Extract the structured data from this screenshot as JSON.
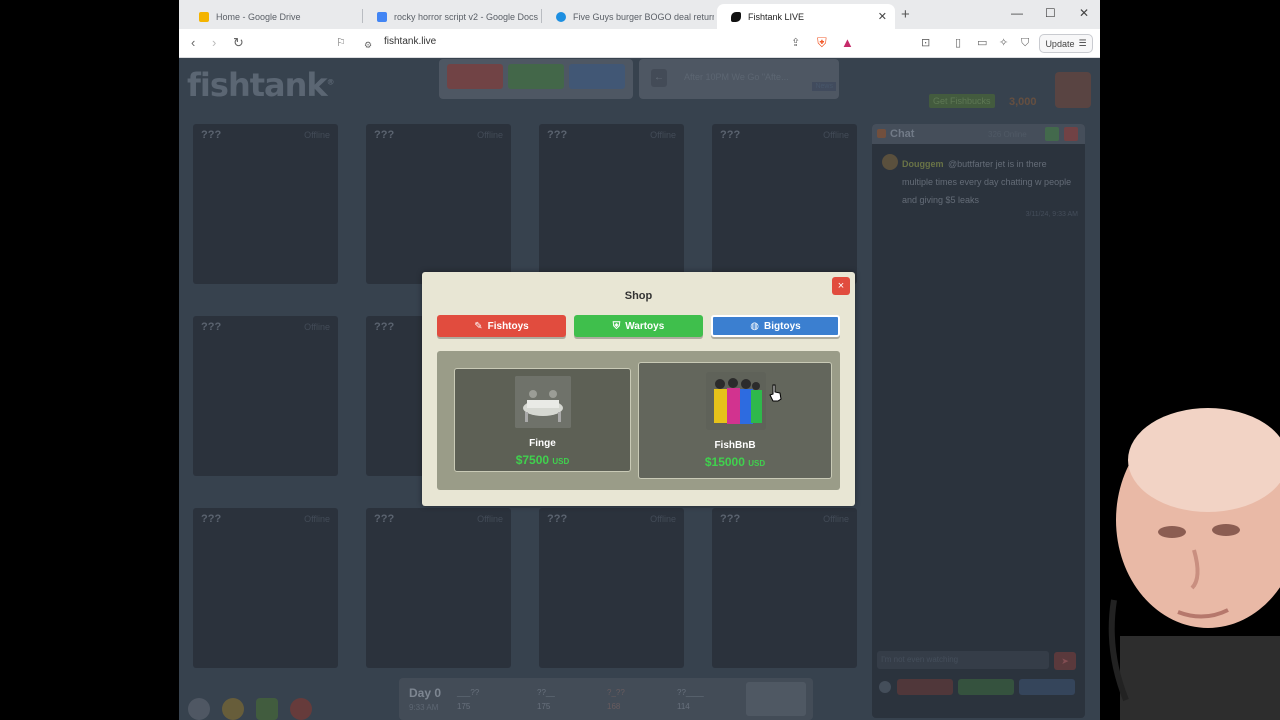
{
  "browser": {
    "tabs": [
      {
        "title": "Home - Google Drive",
        "favicon_color": "#1a73e8"
      },
      {
        "title": "rocky horror script v2 - Google Docs",
        "favicon_color": "#4285f4"
      },
      {
        "title": "Five Guys burger BOGO deal returns",
        "favicon_color": "#1d8fe1"
      },
      {
        "title": "Fishtank LIVE",
        "favicon_color": "#111111"
      }
    ],
    "url": "fishtank.live",
    "update_label": "Update"
  },
  "site": {
    "logo": "fishtank",
    "news_text": "After 10PM We Go \"Afte...",
    "news_tag": "News",
    "get_fishbucks": "Get Fishbucks",
    "coins": "3,000"
  },
  "cams": [
    {
      "label": "???",
      "status": "Offline"
    },
    {
      "label": "???",
      "status": "Offline"
    },
    {
      "label": "???",
      "status": "Offline"
    },
    {
      "label": "???",
      "status": "Offline"
    },
    {
      "label": "???",
      "status": "Offline"
    },
    {
      "label": "???",
      "status": ""
    },
    {
      "label": "???",
      "status": "Offline"
    },
    {
      "label": "???",
      "status": "Offline"
    },
    {
      "label": "???",
      "status": "Offline"
    },
    {
      "label": "???",
      "status": "Offline"
    }
  ],
  "chat": {
    "title": "Chat",
    "online": "326 Online",
    "message": {
      "user": "Douggem",
      "text": "@buttfarter jet is in there multiple times every day chatting w people and giving $5 leaks",
      "time": "3/11/24, 9:33 AM"
    },
    "placeholder": "I'm not even watching"
  },
  "status": {
    "day": "Day 0",
    "time": "9:33 AM",
    "stats": [
      {
        "name": "___??",
        "value": "175"
      },
      {
        "name": "??__",
        "value": "175"
      },
      {
        "name": "?_??",
        "value": "168"
      },
      {
        "name": "??____",
        "value": "114"
      }
    ]
  },
  "shop": {
    "title": "Shop",
    "close_label": "×",
    "tabs": [
      {
        "label": "Fishtoys",
        "icon": "fish-icon"
      },
      {
        "label": "Wartoys",
        "icon": "shield-icon"
      },
      {
        "label": "Bigtoys",
        "icon": "globe-icon"
      }
    ],
    "items": [
      {
        "name": "Finge",
        "price": "$7500",
        "currency": "USD"
      },
      {
        "name": "FishBnB",
        "price": "$15000",
        "currency": "USD"
      }
    ]
  }
}
